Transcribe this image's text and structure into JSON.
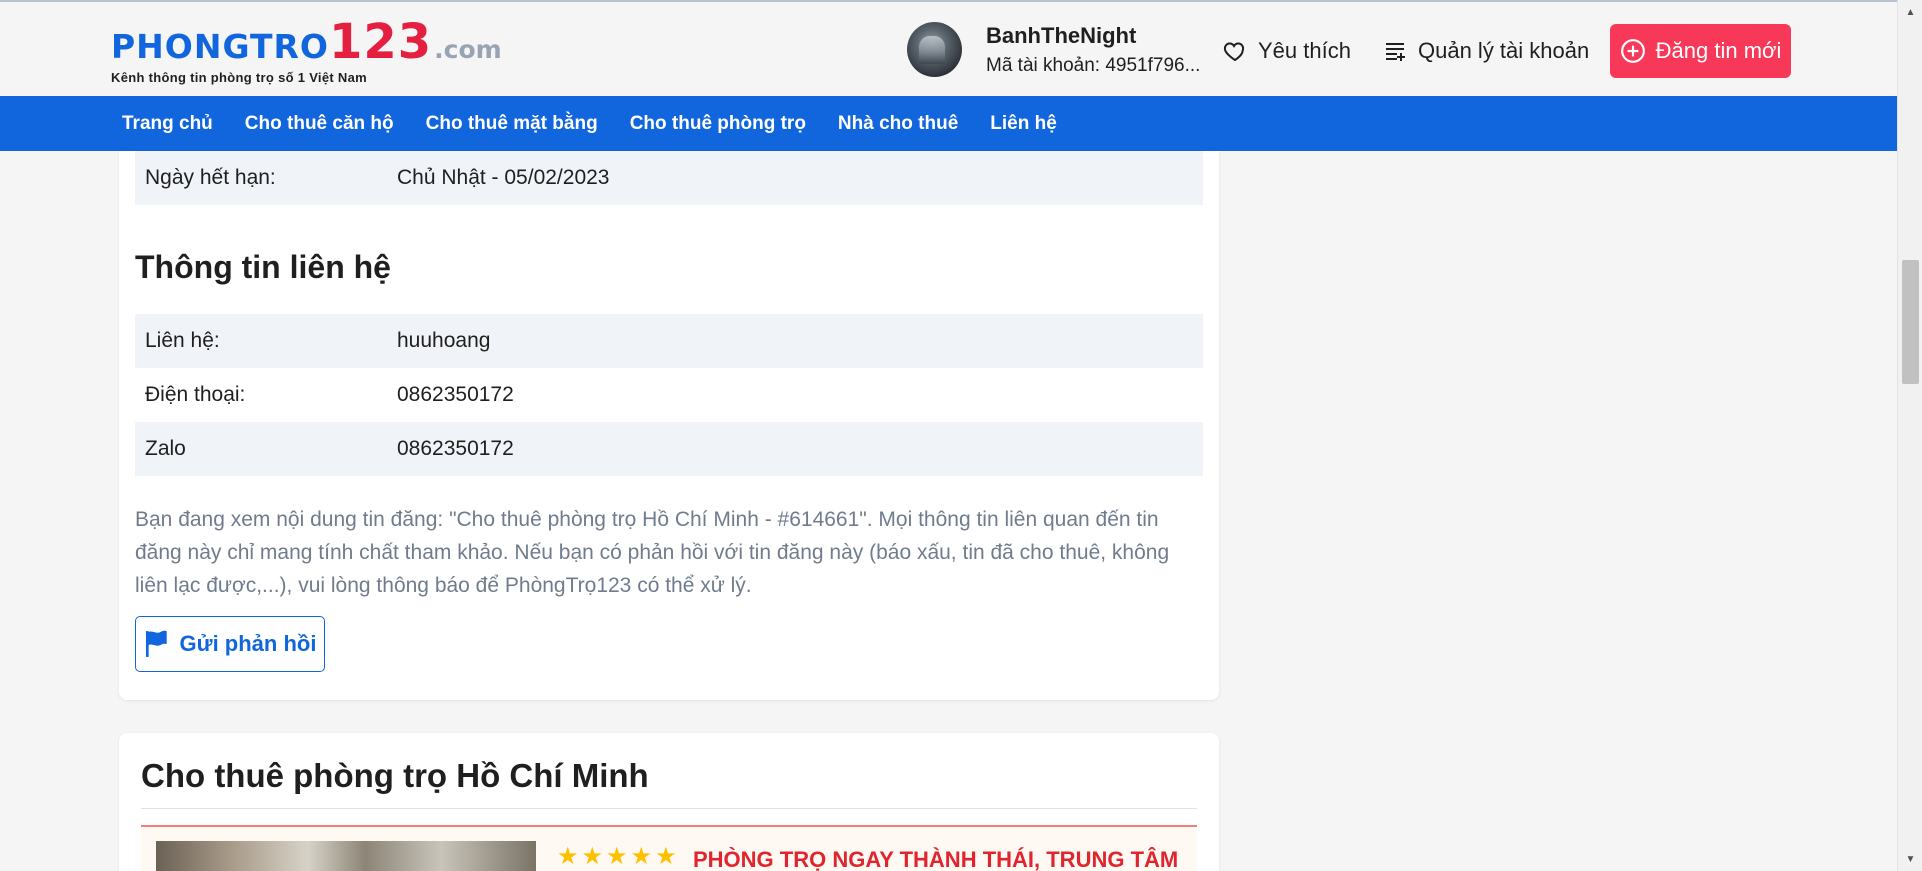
{
  "header": {
    "logo_main": "PHONGTRO",
    "logo_num": "123",
    "logo_com": ".com",
    "slogan": "Kênh thông tin phòng trọ số 1 Việt Nam",
    "user_name": "BanhTheNight",
    "user_id": "Mã tài khoản: 4951f796...",
    "favorites_label": "Yêu thích",
    "account_label": "Quản lý tài khoản",
    "post_label": "Đăng tin mới"
  },
  "nav": {
    "items": [
      "Trang chủ",
      "Cho thuê căn hộ",
      "Cho thuê mặt bằng",
      "Cho thuê phòng trọ",
      "Nhà cho thuê",
      "Liên hệ"
    ]
  },
  "post": {
    "expiry_label": "Ngày hết hạn:",
    "expiry_value": "Chủ Nhật - 05/02/2023",
    "contact_title": "Thông tin liên hệ",
    "contact_rows": [
      {
        "label": "Liên hệ:",
        "value": "huuhoang"
      },
      {
        "label": "Điện thoại:",
        "value": "0862350172"
      },
      {
        "label": "Zalo",
        "value": "0862350172"
      }
    ],
    "note": "Bạn đang xem nội dung tin đăng: \"Cho thuê phòng trọ Hồ Chí Minh - #614661\". Mọi thông tin liên quan đến tin đăng này chỉ mang tính chất tham khảo. Nếu bạn có phản hồi với tin đăng này (báo xấu, tin đã cho thuê, không liên lạc được,...), vui lòng thông báo để PhòngTrọ123 có thể xử lý.",
    "feedback_label": "Gửi phản hồi"
  },
  "related": {
    "title": "Cho thuê phòng trọ Hồ Chí Minh",
    "listing": {
      "rating_stars": 5,
      "title": "PHÒNG TRỌ NGAY THÀNH THÁI, TRUNG TÂM"
    }
  },
  "colors": {
    "brand_blue": "#1266dd",
    "brand_red": "#f73859",
    "listing_red": "#e0252e",
    "star": "#ffc000"
  }
}
